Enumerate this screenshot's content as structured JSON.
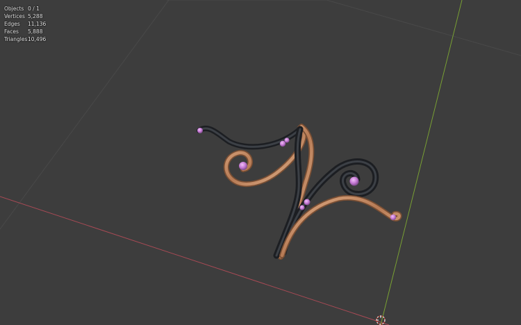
{
  "stats": {
    "objects": {
      "label": "Objects",
      "value": "0 / 1"
    },
    "vertices": {
      "label": "Vertices",
      "value": "5,288"
    },
    "edges": {
      "label": "Edges",
      "value": "11,136"
    },
    "faces": {
      "label": "Faces",
      "value": "5,888"
    },
    "triangles": {
      "label": "Triangles",
      "value": "10,496"
    }
  },
  "colors": {
    "background": "#3d3d3d",
    "grid": "#494949",
    "x_axis": "#a84a55",
    "y_axis": "#7aa233",
    "gold": "#c8906a",
    "dark_metal": "#2a2d31",
    "gem": "#c77bd6"
  }
}
